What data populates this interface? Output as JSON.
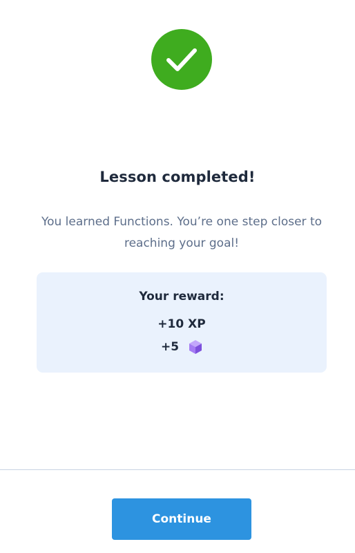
{
  "colors": {
    "success_green": "#3fac1f",
    "title_text": "#1f2a3c",
    "subtitle_text": "#5d6e8a",
    "reward_card_bg": "#eaf2fd",
    "gem_purple": "#9b6cf0",
    "divider": "#c7d3e3",
    "button_blue": "#2d93e0"
  },
  "status_icon": "check-icon",
  "title": "Lesson completed!",
  "subtitle": "You learned Functions. You’re one step closer to reaching your goal!",
  "reward": {
    "heading": "Your reward:",
    "xp_text": "+10 XP",
    "gems_text": "+5",
    "gem_icon": "gem-icon"
  },
  "continue_label": "Continue"
}
